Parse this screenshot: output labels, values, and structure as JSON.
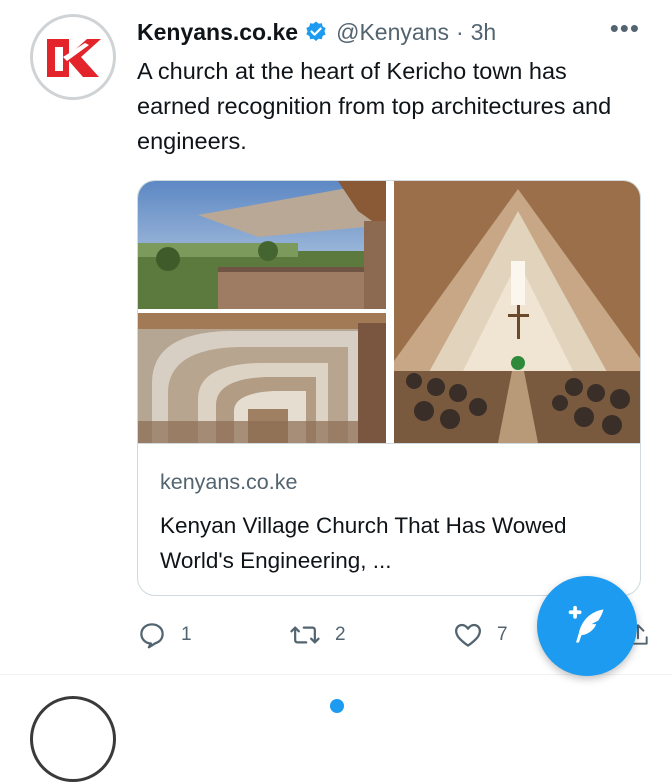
{
  "tweet": {
    "display_name": "Kenyans.co.ke",
    "handle": "@Kenyans",
    "separator": "·",
    "time": "3h",
    "more": "•••",
    "text": "A church at the heart of Kericho town has earned recognition from top architectures and engineers.",
    "avatar_logo": "K-logo"
  },
  "card": {
    "domain": "kenyans.co.ke",
    "title": "Kenyan Village Church That Has Wowed World's Engineering, ...",
    "images": [
      "church-roof-exterior",
      "church-arched-corridor",
      "church-interior-congregation"
    ]
  },
  "actions": {
    "reply_count": "1",
    "retweet_count": "2",
    "like_count": "7"
  },
  "colors": {
    "accent": "#1d9bf0",
    "logo_red": "#e3242b",
    "text": "#0f1419",
    "muted": "#536471"
  }
}
